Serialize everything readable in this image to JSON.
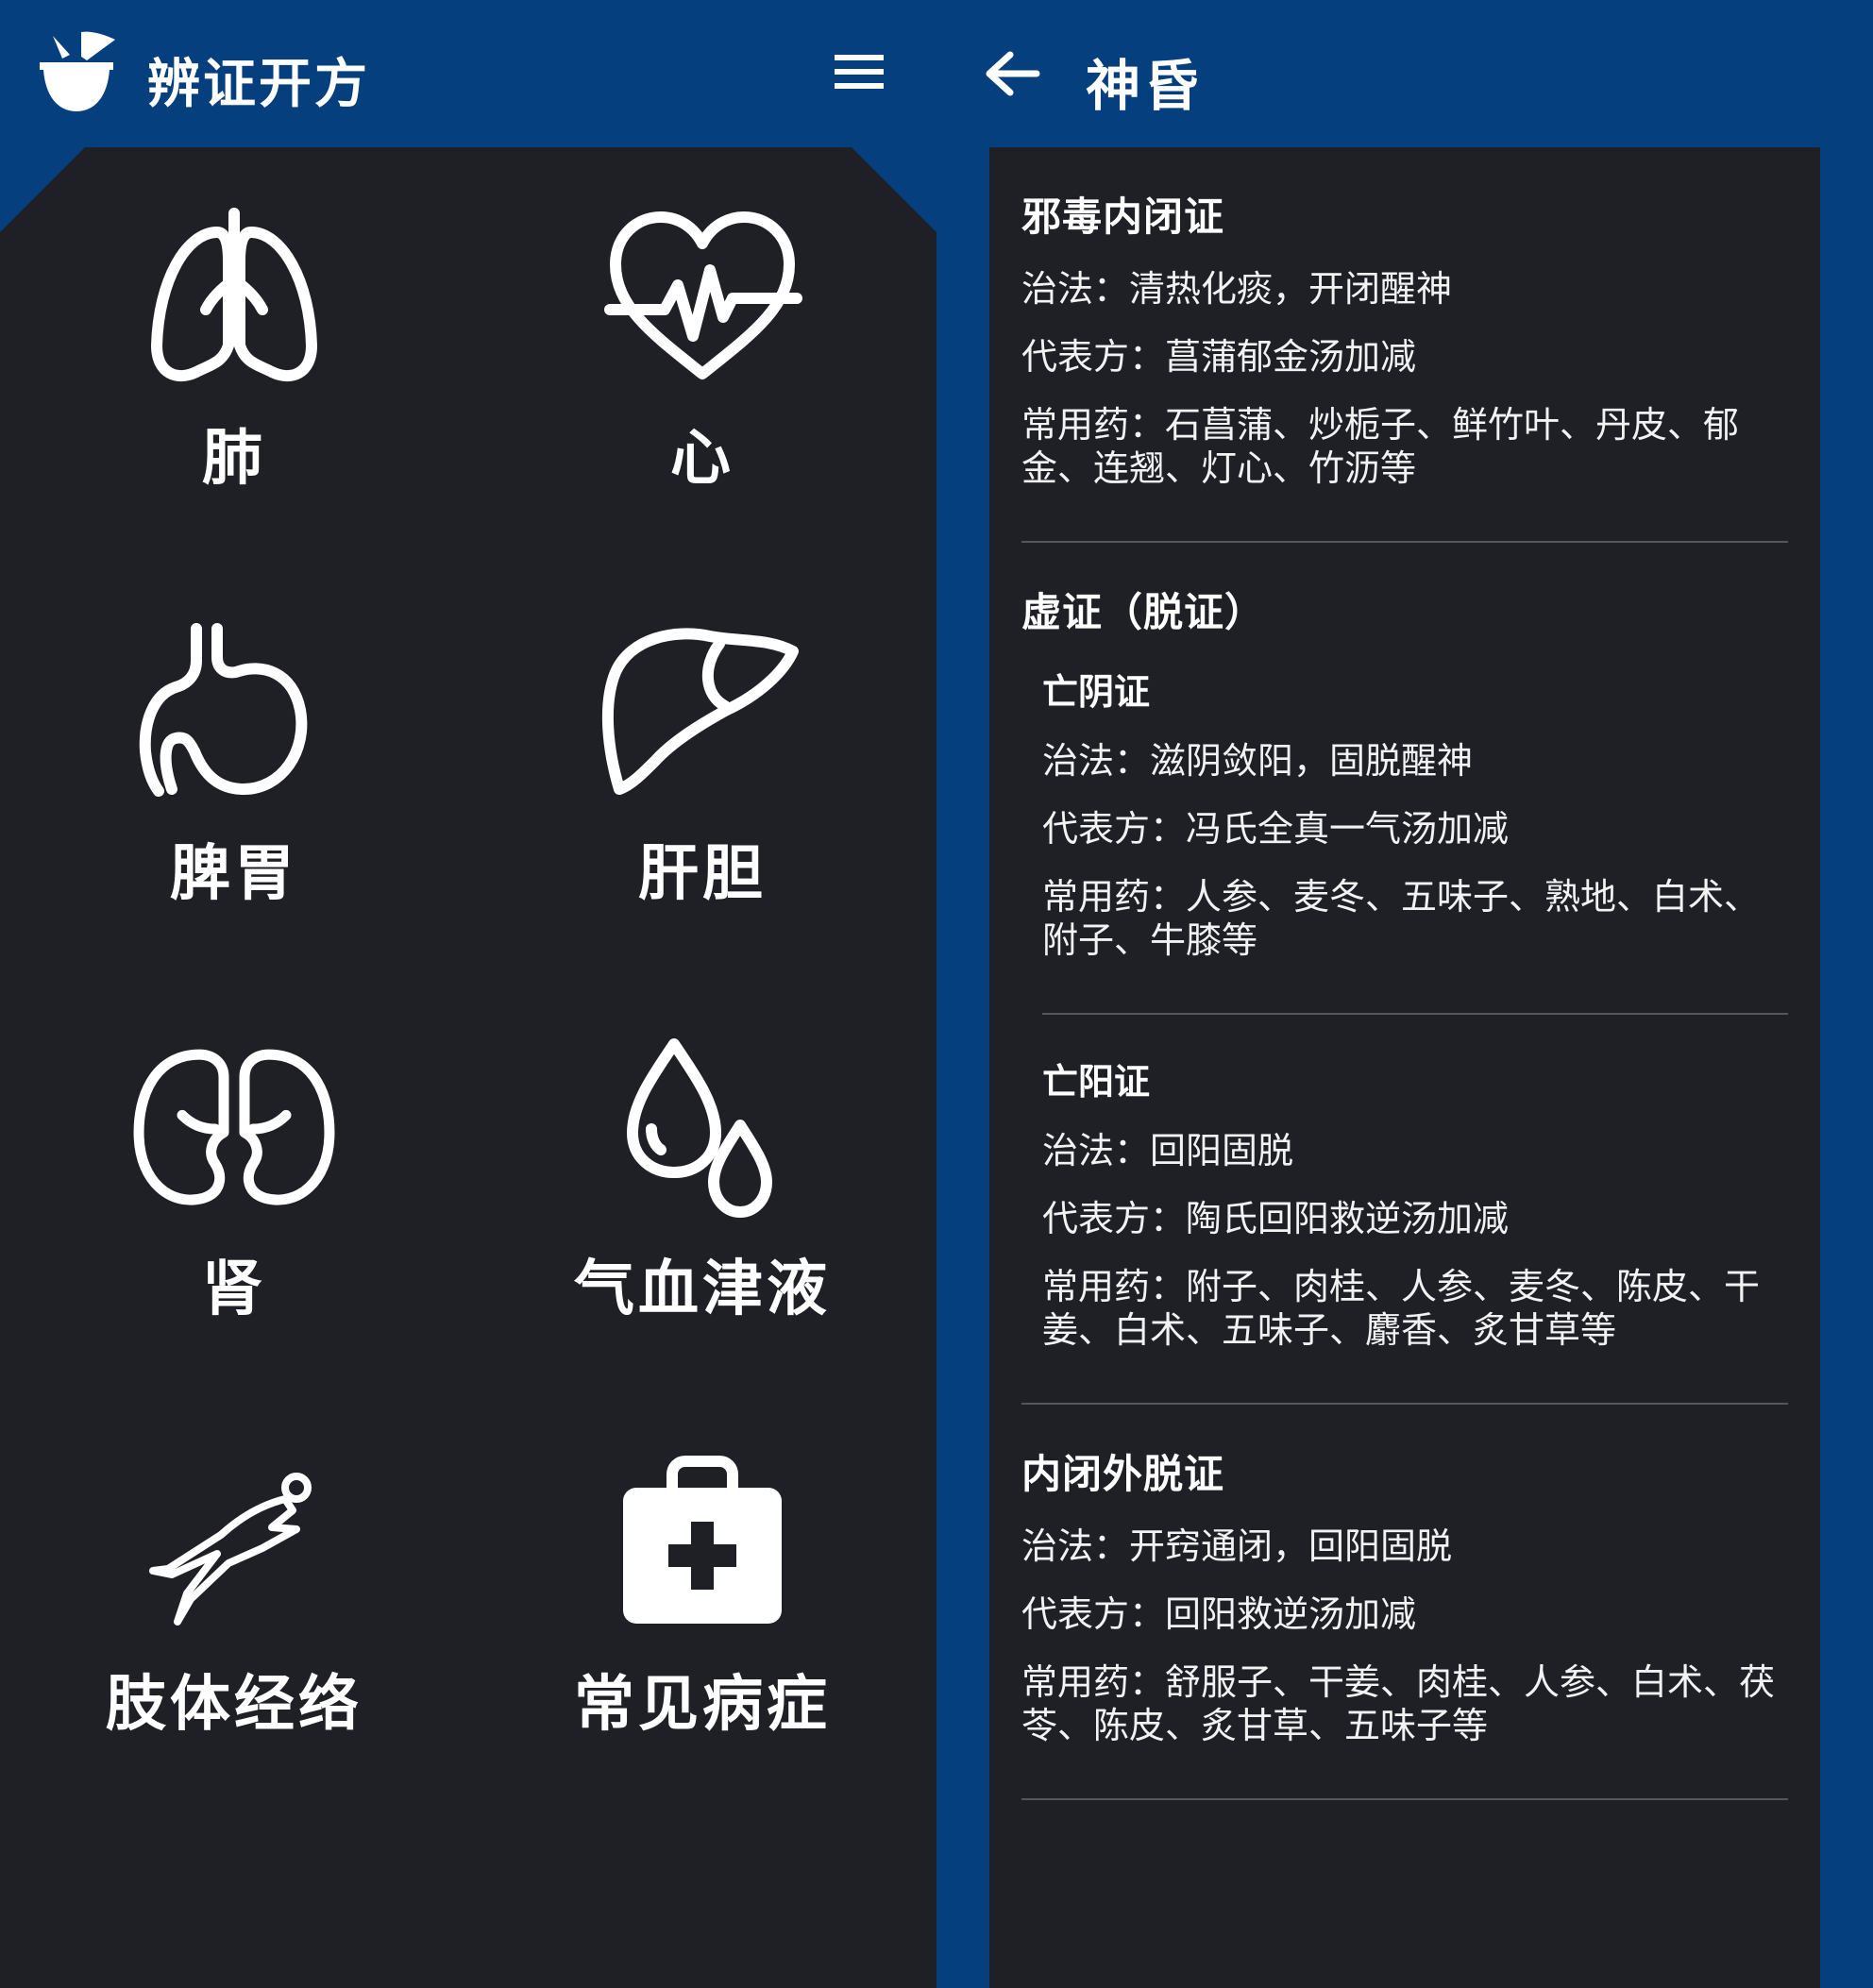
{
  "left": {
    "app_title": "辨证开方",
    "tiles": [
      {
        "label": "肺",
        "icon": "lungs-icon"
      },
      {
        "label": "心",
        "icon": "heart-pulse-icon"
      },
      {
        "label": "脾胃",
        "icon": "stomach-icon"
      },
      {
        "label": "肝胆",
        "icon": "liver-icon"
      },
      {
        "label": "肾",
        "icon": "kidneys-icon"
      },
      {
        "label": "气血津液",
        "icon": "drops-icon"
      },
      {
        "label": "肢体经络",
        "icon": "body-figure-icon"
      },
      {
        "label": "常见病症",
        "icon": "first-aid-kit-icon"
      }
    ]
  },
  "right": {
    "page_title": "神昏",
    "sections": [
      {
        "title": "邪毒内闭证",
        "method": "治法：清热化痰，开闭醒神",
        "formula": "代表方：菖蒲郁金汤加减",
        "herbs": "常用药：石菖蒲、炒栀子、鲜竹叶、丹皮、郁金、连翘、灯心、竹沥等"
      },
      {
        "title": "虚证（脱证）",
        "subs": [
          {
            "title": "亡阴证",
            "method": "治法：滋阴敛阳，固脱醒神",
            "formula": "代表方：冯氏全真一气汤加减",
            "herbs": "常用药：人参、麦冬、五味子、熟地、白术、附子、牛膝等"
          },
          {
            "title": "亡阳证",
            "method": "治法：回阳固脱",
            "formula": "代表方：陶氏回阳救逆汤加减",
            "herbs": "常用药：附子、肉桂、人参、麦冬、陈皮、干姜、白术、五味子、麝香、炙甘草等"
          }
        ]
      },
      {
        "title": "内闭外脱证",
        "method": "治法：开窍通闭，回阳固脱",
        "formula": "代表方：回阳救逆汤加减",
        "herbs": "常用药：舒服子、干姜、肉桂、人参、白术、茯苓、陈皮、炙甘草、五味子等"
      }
    ]
  },
  "colors": {
    "header_blue": "#063f7e",
    "panel_dark": "#1f2026",
    "divider": "#55565c"
  }
}
